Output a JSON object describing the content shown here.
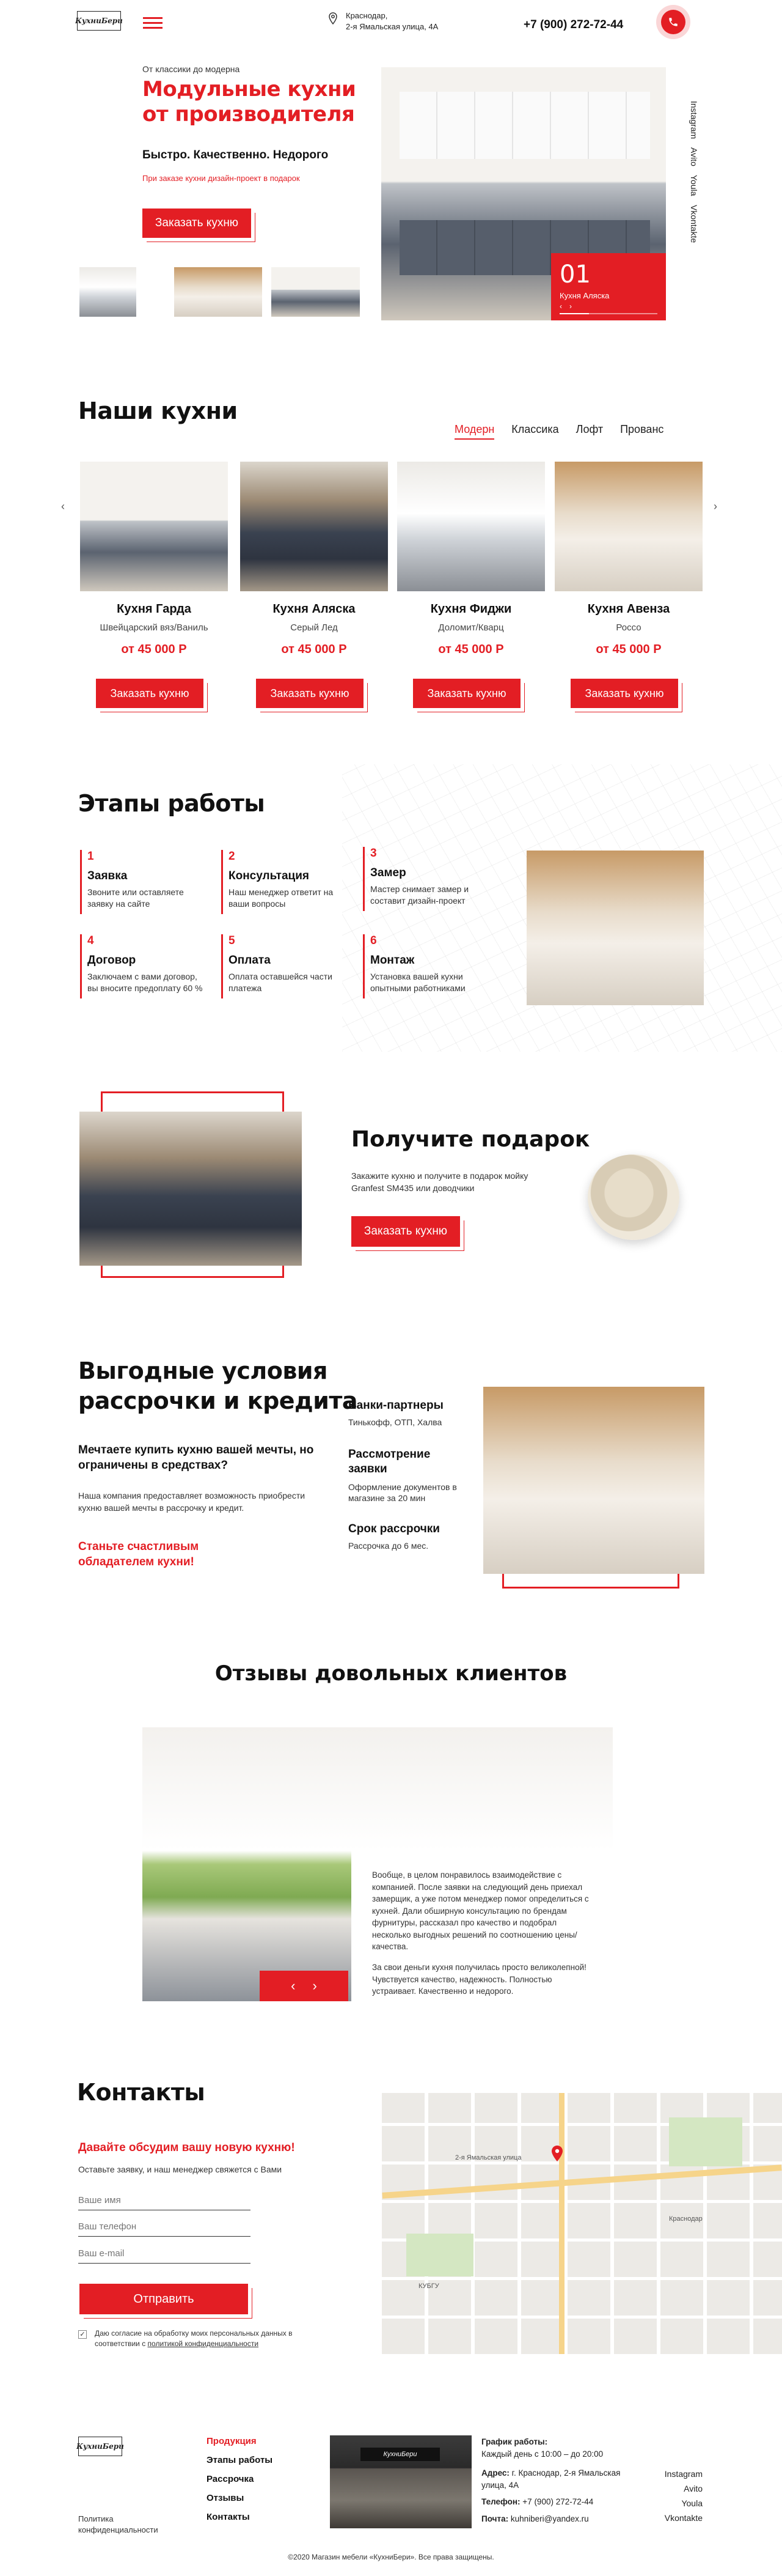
{
  "header": {
    "logo": "КухниБери",
    "address_line1": "Краснодар,",
    "address_line2": "2-я Ямальская улица, 4А",
    "phone": "+7 (900) 272-72-44"
  },
  "hero": {
    "kicker": "От классики до модерна",
    "title_line1": "Модульные кухни",
    "title_line2": "от производителя",
    "tagline": "Быстро. Качественно. Недорого",
    "note": "При заказе кухни дизайн-проект в подарок",
    "cta": "Заказать кухню",
    "slide_num": "01",
    "slide_name": "Кухня Аляска",
    "social": [
      "Instagram",
      "Avito",
      "Youla",
      "Vkontakte"
    ]
  },
  "kitchens": {
    "title": "Наши кухни",
    "tabs": [
      "Модерн",
      "Классика",
      "Лофт",
      "Прованс"
    ],
    "active_tab": "Модерн",
    "cards": [
      {
        "name": "Кухня Гарда",
        "color": "Швейцарский вяз/Ваниль",
        "price": "от 45 000 Р",
        "cta": "Заказать кухню"
      },
      {
        "name": "Кухня Аляска",
        "color": "Серый Лед",
        "price": "от 45 000 Р",
        "cta": "Заказать кухню"
      },
      {
        "name": "Кухня Фиджи",
        "color": "Доломит/Кварц",
        "price": "от 45 000 Р",
        "cta": "Заказать кухню"
      },
      {
        "name": "Кухня Авенза",
        "color": "Россо",
        "price": "от 45 000 Р",
        "cta": "Заказать кухню"
      }
    ]
  },
  "steps": {
    "title": "Этапы работы",
    "items": [
      {
        "num": "1",
        "title": "Заявка",
        "desc": "Звоните или оставляете заявку на сайте"
      },
      {
        "num": "2",
        "title": "Консультация",
        "desc": "Наш менеджер ответит на ваши вопросы"
      },
      {
        "num": "3",
        "title": "Замер",
        "desc": "Мастер снимает замер и составит дизайн-проект"
      },
      {
        "num": "4",
        "title": "Договор",
        "desc": "Заключаем с вами договор, вы вносите предоплату 60 %"
      },
      {
        "num": "5",
        "title": "Оплата",
        "desc": "Оплата оставшейся части платежа"
      },
      {
        "num": "6",
        "title": "Монтаж",
        "desc": "Установка вашей кухни опытными работниками"
      }
    ]
  },
  "gift": {
    "title": "Получите подарок",
    "desc": "Закажите кухню и получите в подарок мойку Granfest SM435 или доводчики",
    "cta": "Заказать кухню"
  },
  "credit": {
    "title_line1": "Выгодные условия",
    "title_line2": "рассрочки и кредита",
    "subtitle": "Мечтаете купить кухню вашей мечты, но ограничены в средствах?",
    "text": "Наша компания предоставляет возможность приобрести кухню вашей мечты в рассрочку и кредит.",
    "highlight": "Станьте счастливым обладателем кухни!",
    "items": [
      {
        "title": "Банки-партнеры",
        "desc": "Тинькофф, ОТП, Халва"
      },
      {
        "title": "Рассмотрение заявки",
        "desc": "Оформление документов в магазине за 20 мин"
      },
      {
        "title": "Срок рассрочки",
        "desc": "Рассрочка до 6 мес."
      }
    ]
  },
  "reviews": {
    "title": "Отзывы довольных клиентов",
    "text1": "Вообще, в целом понравилось взаимодействие с компанией. После заявки на следующий день приехал замерщик, а уже потом менеджер помог определиться с кухней. Дали обширную консультацию по брендам фурнитуры, рассказал про качество и подобрал несколько выгодных решений по соотношению цены/качества.",
    "text2": "За свои деньги кухня получилась просто великолепной! Чувствуется качество, надежность. Полностью устраивает. Качественно и недорого.",
    "prev": "‹",
    "next": "›"
  },
  "contacts": {
    "title": "Контакты",
    "subtitle": "Давайте обсудим вашу новую кухню!",
    "desc": "Оставьте заявку, и наш менеджер свяжется с Вами",
    "name_placeholder": "Ваше имя",
    "phone_placeholder": "Ваш телефон",
    "email_placeholder": "Ваш e-mail",
    "submit": "Отправить",
    "consent_prefix": "Даю согласие на обработку моих персональных данных в соответствии с ",
    "consent_link": "политикой конфиденциальности",
    "map_labels": [
      "2-я Ямальская улица",
      "Краснодар",
      "КУБГУ"
    ]
  },
  "footer": {
    "logo": "КухниБери",
    "policy": "Политика конфиденциальности",
    "nav": [
      "Продукция",
      "Этапы работы",
      "Рассрочка",
      "Отзывы",
      "Контакты"
    ],
    "schedule_title": "График работы:",
    "schedule": "Каждый день с 10:00 – до 20:00",
    "address_label": "Адрес:",
    "address": "г. Краснодар, 2-я Ямальская улица, 4А",
    "phone_label": "Телефон:",
    "phone": "+7 (900) 272-72-44",
    "mail_label": "Почта:",
    "mail": "kuhniberi@yandex.ru",
    "social": [
      "Instagram",
      "Avito",
      "Youla",
      "Vkontakte"
    ],
    "copyright": "©2020 Магазин мебели «КухниБери». Все права защищены."
  },
  "colors": {
    "accent": "#e31e24",
    "text": "#222222"
  }
}
